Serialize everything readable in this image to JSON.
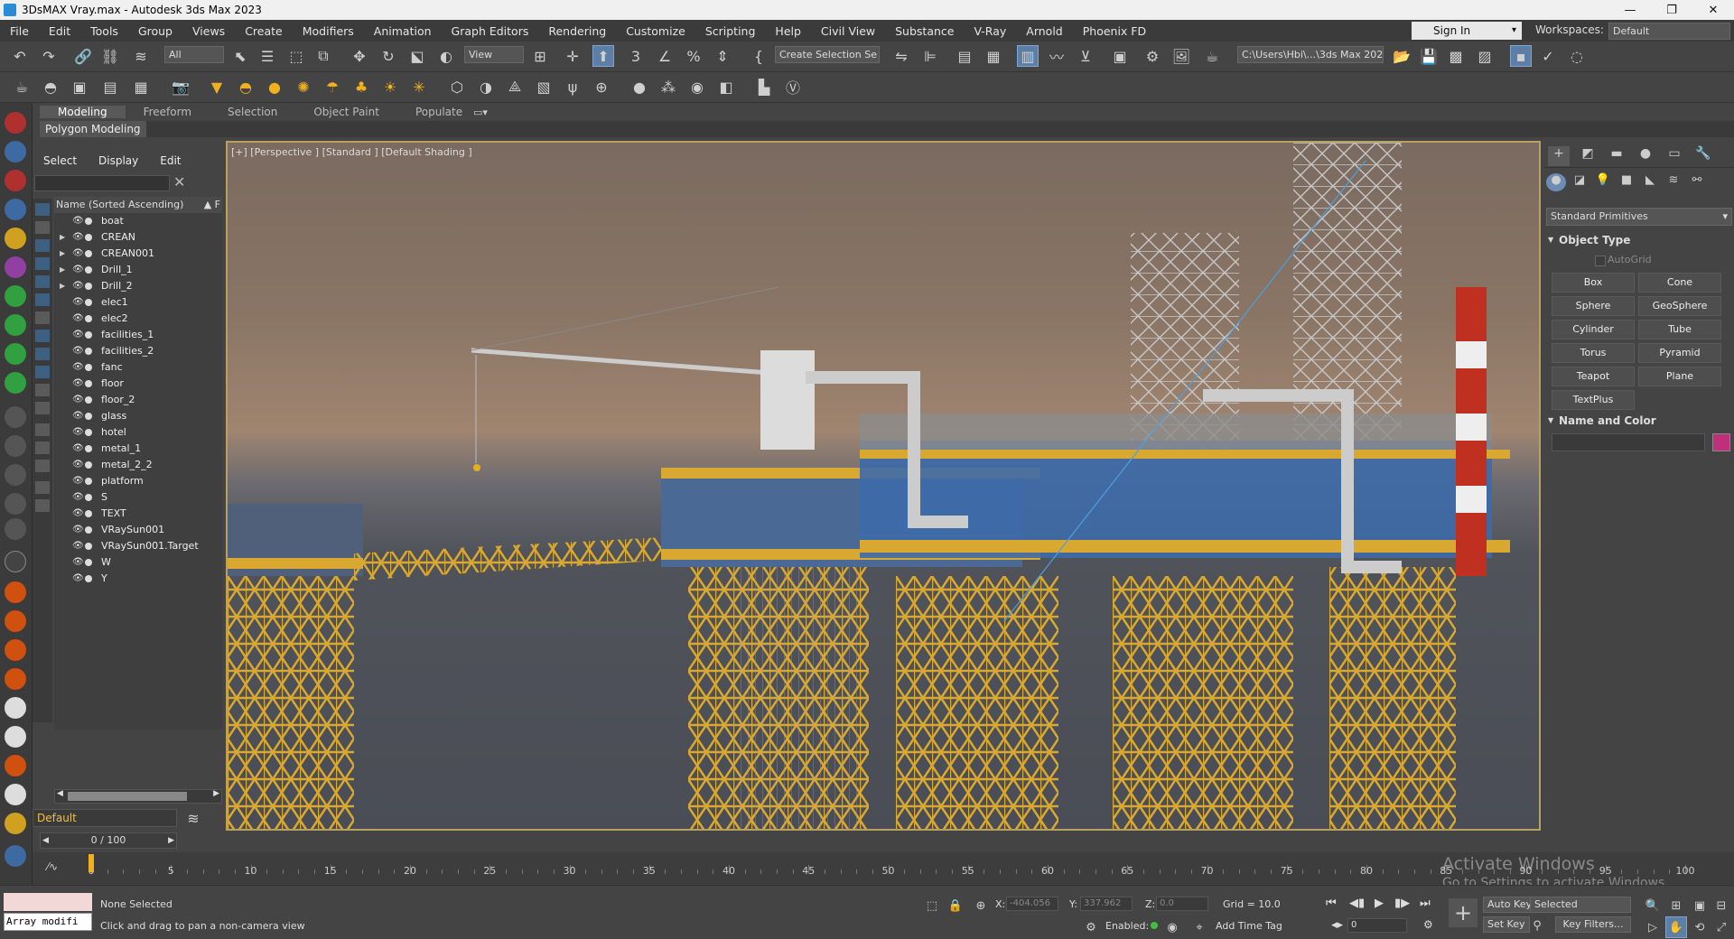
{
  "window": {
    "title": "3DsMAX Vray.max - Autodesk 3ds Max 2023"
  },
  "menu": [
    "File",
    "Edit",
    "Tools",
    "Group",
    "Views",
    "Create",
    "Modifiers",
    "Animation",
    "Graph Editors",
    "Rendering",
    "Customize",
    "Scripting",
    "Help",
    "Civil View",
    "Substance",
    "V-Ray",
    "Arnold",
    "Phoenix FD"
  ],
  "header": {
    "sign_in": "Sign In",
    "workspaces_label": "Workspaces:",
    "workspace": "Default"
  },
  "toolbar": {
    "selection_filter": "All",
    "ref_coord": "View",
    "named_selection": "Create Selection Se",
    "project_path": "C:\\Users\\Hbi\\...\\3ds Max 2023"
  },
  "ribbon": {
    "tabs": [
      "Modeling",
      "Freeform",
      "Selection",
      "Object Paint",
      "Populate"
    ],
    "active": "Modeling",
    "sub": "Polygon Modeling"
  },
  "scene_explorer": {
    "menu": [
      "Select",
      "Display",
      "Edit"
    ],
    "column_header": "Name (Sorted Ascending)",
    "column_sort": "▲ F",
    "items": [
      {
        "name": "boat",
        "expand": false
      },
      {
        "name": "CREAN",
        "expand": true
      },
      {
        "name": "CREAN001",
        "expand": true
      },
      {
        "name": "Drill_1",
        "expand": true
      },
      {
        "name": "Drill_2",
        "expand": true
      },
      {
        "name": "elec1",
        "expand": false
      },
      {
        "name": "elec2",
        "expand": false
      },
      {
        "name": "facilities_1",
        "expand": false
      },
      {
        "name": "facilities_2",
        "expand": false
      },
      {
        "name": "fanc",
        "expand": false
      },
      {
        "name": "floor",
        "expand": false
      },
      {
        "name": "floor_2",
        "expand": false
      },
      {
        "name": "glass",
        "expand": false
      },
      {
        "name": "hotel",
        "expand": false
      },
      {
        "name": "metal_1",
        "expand": false
      },
      {
        "name": "metal_2_2",
        "expand": false
      },
      {
        "name": "platform",
        "expand": false
      },
      {
        "name": "S",
        "expand": false
      },
      {
        "name": "TEXT",
        "expand": false
      },
      {
        "name": "VRaySun001",
        "expand": false
      },
      {
        "name": "VRaySun001.Target",
        "expand": false
      },
      {
        "name": "W",
        "expand": false
      },
      {
        "name": "Y",
        "expand": false
      }
    ],
    "layer": "Default"
  },
  "viewport": {
    "label": "[+] [Perspective ] [Standard ] [Default Shading ]"
  },
  "command_panel": {
    "category": "Standard Primitives",
    "object_type_title": "Object Type",
    "autogrid": "AutoGrid",
    "primitives": [
      "Box",
      "Cone",
      "Sphere",
      "GeoSphere",
      "Cylinder",
      "Tube",
      "Torus",
      "Pyramid",
      "Teapot",
      "Plane",
      "TextPlus"
    ],
    "name_color_title": "Name and Color",
    "object_color": "#c0307a"
  },
  "timeline": {
    "frame": "0 / 100",
    "ticks": [
      "0",
      "5",
      "10",
      "15",
      "20",
      "25",
      "30",
      "35",
      "40",
      "45",
      "50",
      "55",
      "60",
      "65",
      "70",
      "75",
      "80",
      "85",
      "90",
      "95",
      "100"
    ]
  },
  "status": {
    "maxscript": "Array modifi",
    "selection": "None Selected",
    "prompt": "Click and drag to pan a non-camera view",
    "x_label": "X:",
    "x": "-404.056",
    "y_label": "Y:",
    "y": "337.962",
    "z_label": "Z:",
    "z": "0.0",
    "grid": "Grid = 10.0",
    "enabled": "Enabled:",
    "add_time_tag": "Add Time Tag",
    "auto_key": "Auto Key",
    "set_key": "Set Key",
    "key_mode": "Selected",
    "key_filters": "Key Filters...",
    "frame_field": "0"
  },
  "watermark": {
    "line1": "Activate Windows",
    "line2": "Go to Settings to activate Windows."
  }
}
